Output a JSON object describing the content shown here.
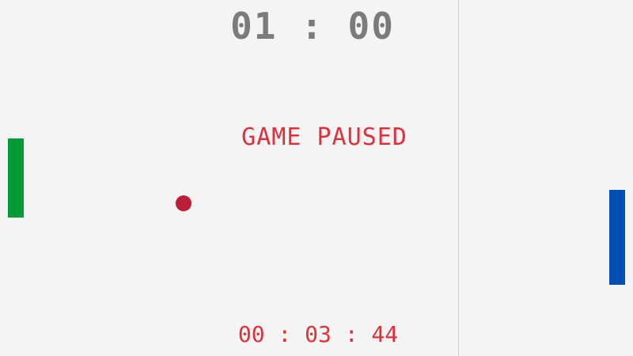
{
  "score": {
    "text": "01 : 00",
    "left": "01",
    "right": "00"
  },
  "status": {
    "text": "GAME PAUSED"
  },
  "timer": {
    "text": "00 : 03 : 44"
  },
  "colors": {
    "background": "#f4f4f4",
    "divider": "#cfcfcf",
    "score": "#7b7b7b",
    "status": "#e0303a",
    "timer": "#e0303a",
    "left_paddle": "#009933",
    "right_paddle": "#0050b4",
    "ball": "#bb1e36"
  }
}
